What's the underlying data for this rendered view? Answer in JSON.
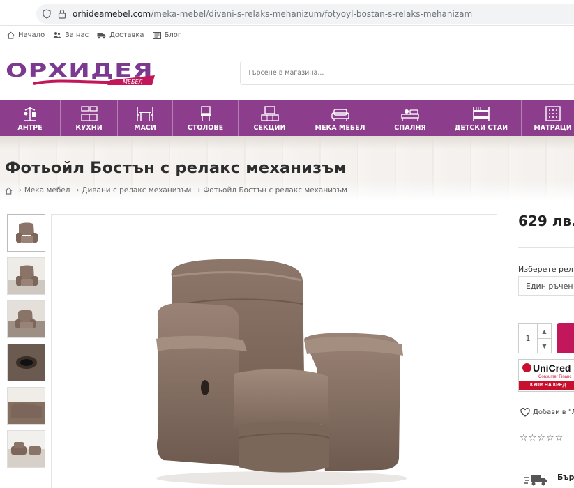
{
  "browser": {
    "url_host": "orhideamebel.com",
    "url_path": "/meka-mebel/divani-s-relaks-mehanizum/fotyoyl-bostan-s-relaks-mehanizam"
  },
  "toplinks": [
    {
      "label": "Начало",
      "icon": "home-icon"
    },
    {
      "label": "За нас",
      "icon": "people-icon"
    },
    {
      "label": "Доставка",
      "icon": "truck-icon"
    },
    {
      "label": "Блог",
      "icon": "blog-icon"
    }
  ],
  "logo": {
    "main": "ОРХИДЕЯ",
    "sub": "МЕБЕЛ"
  },
  "search": {
    "placeholder": "Търсене в магазина..."
  },
  "nav": [
    {
      "label": "АНТРЕ",
      "icon": "hanger-icon"
    },
    {
      "label": "КУХНИ",
      "icon": "kitchen-icon"
    },
    {
      "label": "МАСИ",
      "icon": "table-icon"
    },
    {
      "label": "СТОЛОВЕ",
      "icon": "chair-icon"
    },
    {
      "label": "СЕКЦИИ",
      "icon": "tv-unit-icon"
    },
    {
      "label": "МЕКА МЕБЕЛ",
      "icon": "sofa-icon"
    },
    {
      "label": "СПАЛНЯ",
      "icon": "bed-icon"
    },
    {
      "label": "ДЕТСКИ СТАИ",
      "icon": "bunk-bed-icon"
    },
    {
      "label": "МАТРАЦИ",
      "icon": "mattress-icon"
    }
  ],
  "product": {
    "title": "Фотьойл Бостън с релакс механизъм",
    "breadcrumbs": [
      "Мека мебел",
      "Дивани с релакс механизъм",
      "Фотьойл Бостън с релакс механизъм"
    ],
    "price": "629 лв.",
    "select_label": "Изберете рел",
    "select_value": "Един ръчен",
    "quantity": "1",
    "wishlist": "Добави в \"Л",
    "stars": "☆☆☆☆☆",
    "delivery": "Бър"
  },
  "unicredit": {
    "brand": "UniCred",
    "sub": "Consumer Financ",
    "strip": "КУПИ НА КРЕД"
  },
  "colors": {
    "nav": "#8c3d8c",
    "cart": "#c2185b",
    "logo_purple": "#7b3a8f",
    "logo_pink": "#c2185b"
  }
}
